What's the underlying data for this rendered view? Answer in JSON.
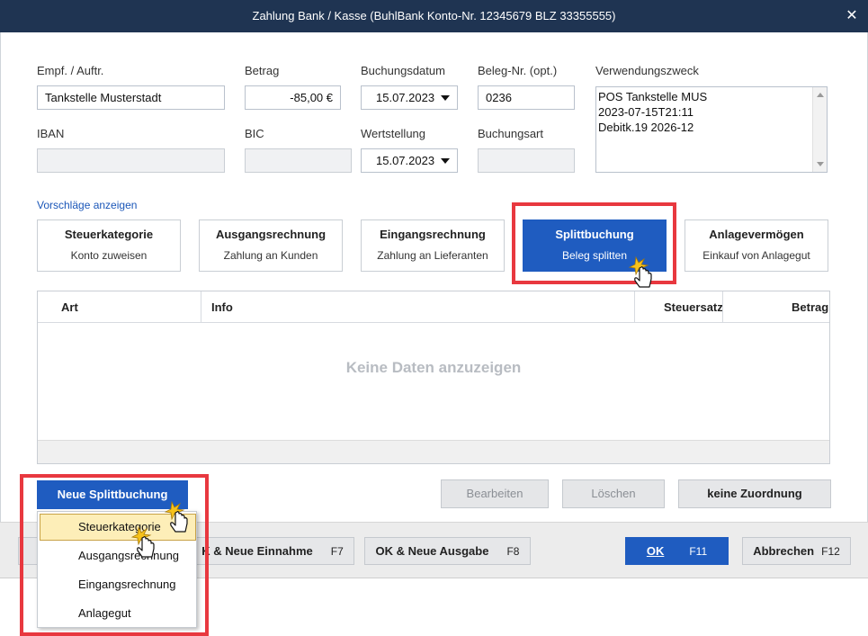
{
  "window": {
    "title": "Zahlung Bank / Kasse (BuhlBank Konto-Nr. 12345679   BLZ 33355555)",
    "close_glyph": "✕"
  },
  "form": {
    "empf_label": "Empf. / Auftr.",
    "empf_value": "Tankstelle Musterstadt",
    "betrag_label": "Betrag",
    "betrag_value": "-85,00 €",
    "buchungsdatum_label": "Buchungsdatum",
    "buchungsdatum_value": "15.07.2023",
    "beleg_label": "Beleg-Nr. (opt.)",
    "beleg_value": "0236",
    "verwendungszweck_label": "Verwendungszweck",
    "verwendungszweck_lines": [
      "POS Tankstelle MUS",
      "2023-07-15T21:11",
      "Debitk.19 2026-12"
    ],
    "iban_label": "IBAN",
    "iban_value": "",
    "bic_label": "BIC",
    "bic_value": "",
    "wertstellung_label": "Wertstellung",
    "wertstellung_value": "15.07.2023",
    "buchungsart_label": "Buchungsart",
    "buchungsart_value": ""
  },
  "suggestions": {
    "link": "Vorschläge anzeigen",
    "cards": [
      {
        "title": "Steuerkategorie",
        "subtitle": "Konto zuweisen"
      },
      {
        "title": "Ausgangsrechnung",
        "subtitle": "Zahlung an Kunden"
      },
      {
        "title": "Eingangsrechnung",
        "subtitle": "Zahlung an Lieferanten"
      },
      {
        "title": "Splittbuchung",
        "subtitle": "Beleg splitten"
      },
      {
        "title": "Anlagevermögen",
        "subtitle": "Einkauf von Anlagegut"
      }
    ],
    "active_index": 3
  },
  "grid": {
    "columns": [
      "Art",
      "Info",
      "Steuersatz",
      "Betrag"
    ],
    "empty_text": "Keine Daten anzuzeigen"
  },
  "actions": {
    "neue_splittbuchung": "Neue Splittbuchung",
    "bearbeiten": "Bearbeiten",
    "loeschen": "Löschen",
    "keine_zuordnung": "keine Zuordnung"
  },
  "dropdown_menu": {
    "items": [
      "Steuerkategorie",
      "Ausgangsrechnung",
      "Eingangsrechnung",
      "Anlagegut"
    ],
    "selected_index": 0
  },
  "footer": {
    "ok_neue_einnahme": "K & Neue Einnahme",
    "ok_neue_einnahme_key": "F7",
    "ok_neue_ausgabe": "OK & Neue Ausgabe",
    "ok_neue_ausgabe_key": "F8",
    "ok": "OK",
    "ok_key": "F11",
    "abbrechen": "Abbrechen",
    "abbrechen_key": "F12"
  },
  "colors": {
    "titlebar": "#1f3452",
    "accent_blue": "#1f5cc0",
    "highlight_red": "#e8383f",
    "menu_selected": "#fdeeb8",
    "link": "#1a56b8"
  },
  "icons": {
    "close": "close-icon",
    "dropdown": "chevron-down-icon",
    "pointer": "hand-pointer-icon"
  }
}
